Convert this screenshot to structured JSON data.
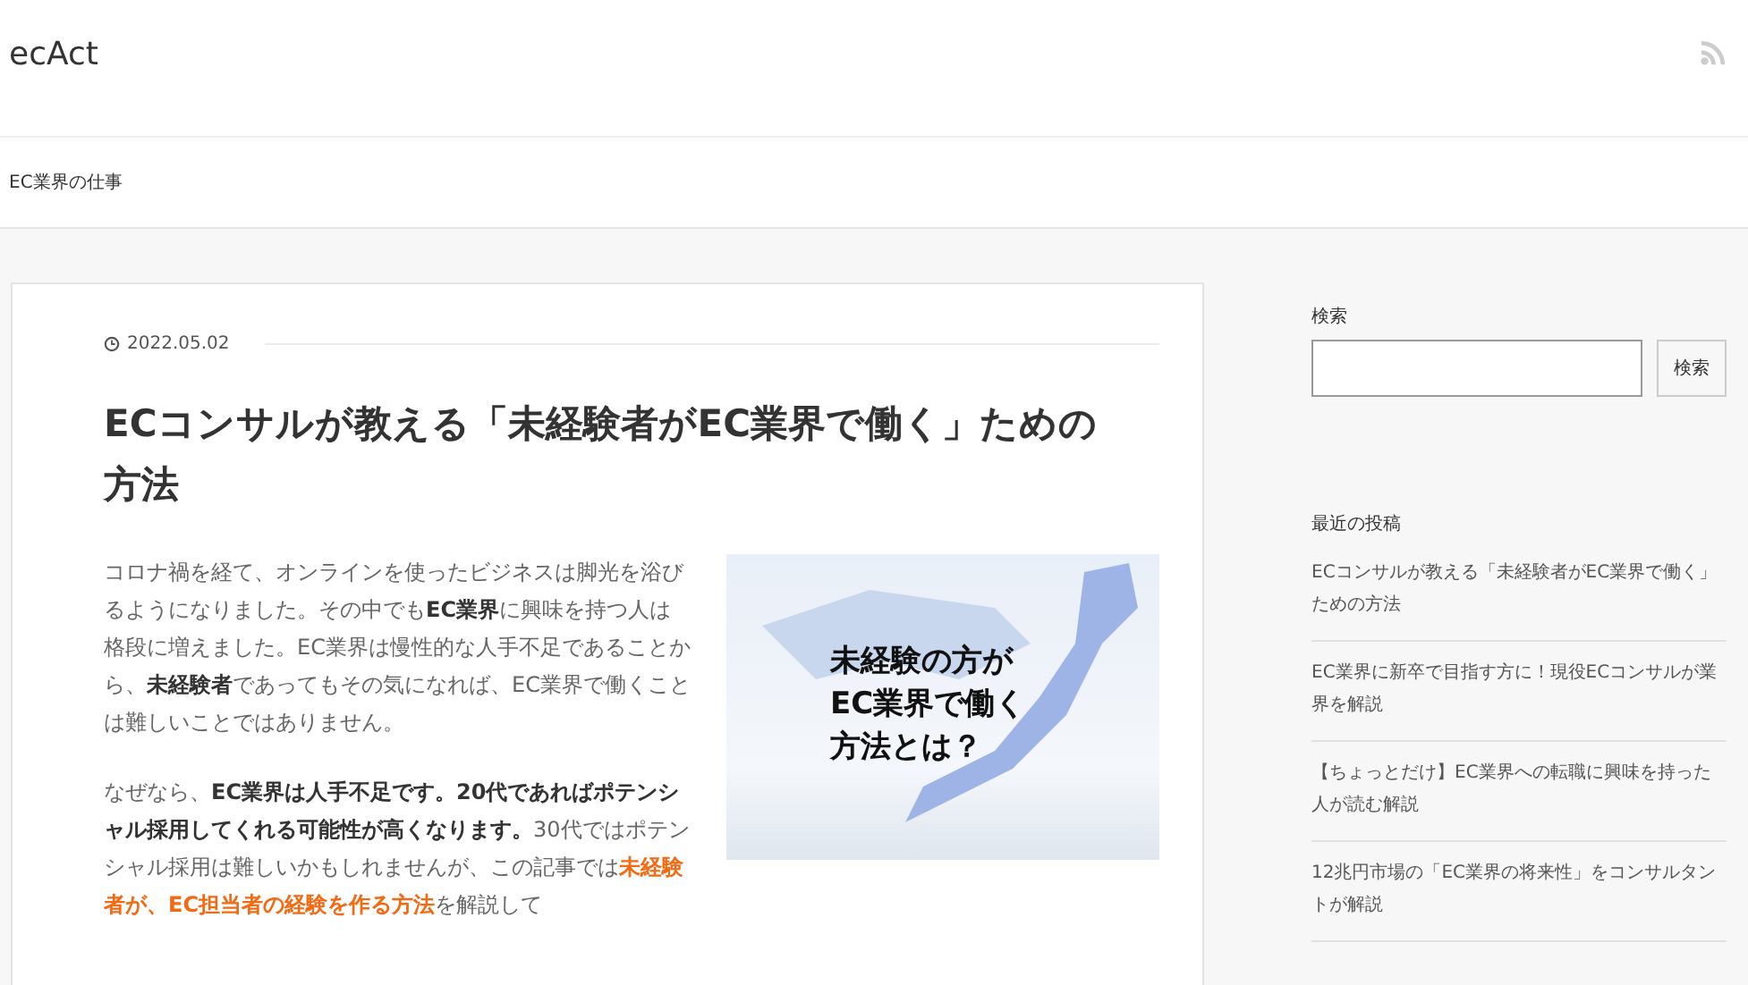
{
  "site": {
    "title": "ecAct"
  },
  "nav": {
    "items": [
      {
        "label": "EC業界の仕事"
      }
    ]
  },
  "article": {
    "date": "2022.05.02",
    "title": "ECコンサルが教える「未経験者がEC業界で働く」ための方法",
    "paragraphs": [
      [
        {
          "kind": "plain",
          "text": "コロナ禍を経て、オンラインを使ったビジネスは脚光を浴びるようになりました。その中でも"
        },
        {
          "kind": "bold",
          "text": "EC業界"
        },
        {
          "kind": "plain",
          "text": "に興味を持つ人は格段に増えました。EC業界は慢性的な人手不足であることから、"
        },
        {
          "kind": "bold",
          "text": "未経験者"
        },
        {
          "kind": "plain",
          "text": "であってもその気になれば、EC業界で働くことは難しいことではありません。"
        }
      ],
      [
        {
          "kind": "plain",
          "text": "なぜなら、"
        },
        {
          "kind": "bold",
          "text": "EC業界は人手不足です。20代であればポテンシャル採用してくれる可能性が高くなります。"
        },
        {
          "kind": "plain",
          "text": "30代ではポテンシャル採用は難しいかもしれませんが、この記事では"
        },
        {
          "kind": "highlight",
          "text": "未経験者が、EC担当者の経験を作る方法"
        },
        {
          "kind": "plain",
          "text": "を解説して"
        }
      ]
    ],
    "image": {
      "caption": [
        "未経験の方が",
        "EC業界で働く",
        "方法とは？"
      ]
    }
  },
  "sidebar": {
    "search": {
      "label": "検索",
      "button": "検索"
    },
    "recent": {
      "heading": "最近の投稿",
      "items": [
        {
          "title": "ECコンサルが教える「未経験者がEC業界で働く」ための方法"
        },
        {
          "title": "EC業界に新卒で目指す方に！現役ECコンサルが業界を解説"
        },
        {
          "title": "【ちょっとだけ】EC業界への転職に興味を持った人が読む解説"
        },
        {
          "title": "12兆円市場の「EC業界の将来性」をコンサルタントが解説"
        }
      ]
    }
  }
}
